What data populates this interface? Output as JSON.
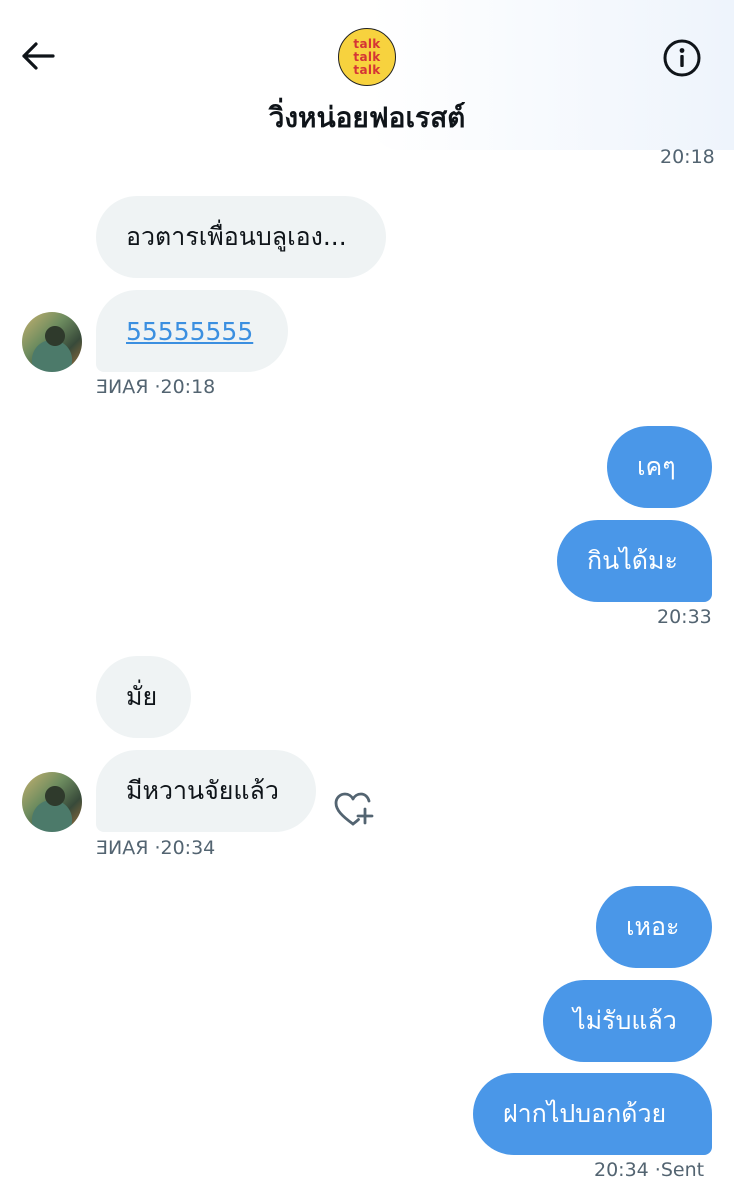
{
  "header": {
    "title": "วิ่งหน่อยฟอเรสต์",
    "logo_lines": [
      "talk",
      "talk",
      "talk"
    ]
  },
  "messages": {
    "time_top": "20:18",
    "in1": "อวตารเพื่อนบลูเอง...",
    "in2": "55555555",
    "meta1": "ƎИΑЯ ·20:18",
    "out1": "เคๆ",
    "out2": "กินได้มะ",
    "time_out1": "20:33",
    "in3": "มั่ย",
    "in4": "มีหวานจัยแล้ว",
    "meta2": "ƎИΑЯ ·20:34",
    "out3": "เหอะ",
    "out4": "ไม่รับแล้ว",
    "out5": "ฝากไปบอกด้วย",
    "time_out2": "20:34 ·Sent"
  },
  "colors": {
    "outgoing_bubble": "#4a97e8",
    "incoming_bubble": "#eff3f4",
    "link": "#3b8fe0",
    "logo_bg": "#f7d23e"
  },
  "icons": [
    "back-arrow-icon",
    "info-icon",
    "heart-plus-icon"
  ]
}
